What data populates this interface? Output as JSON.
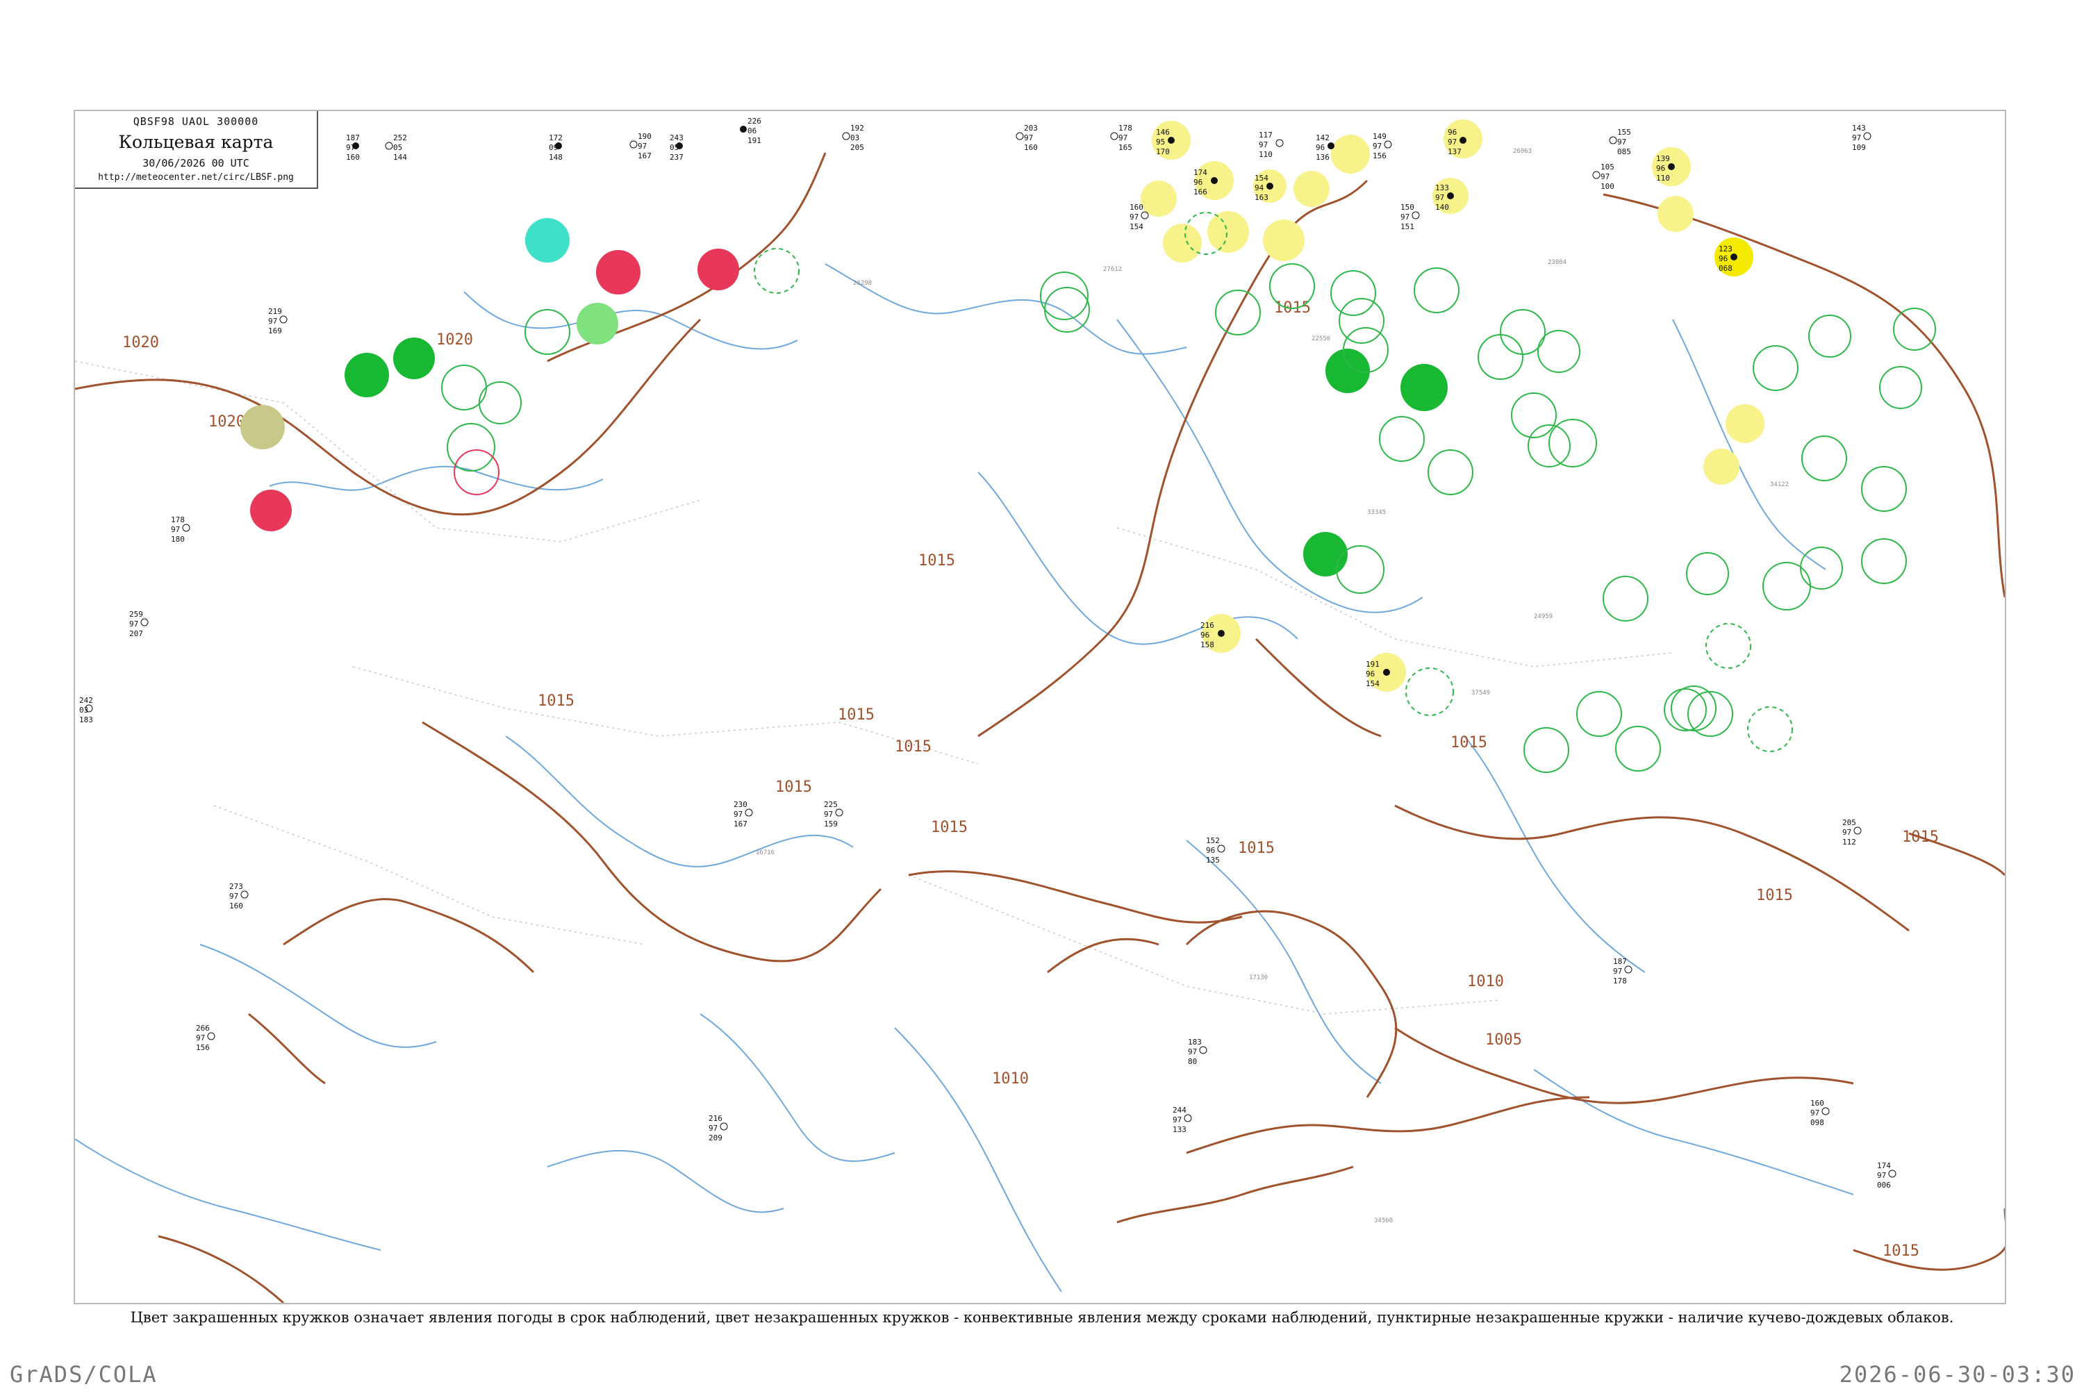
{
  "header": {
    "code": "QBSF98  UAOL  300000",
    "title": "Кольцевая карта",
    "time": "30/06/2026 00 UTC",
    "url": "http://meteocenter.net/circ/LBSF.png"
  },
  "legend_note": "Цвет закрашенных кружков означает явления погоды в срок наблюдений, цвет незакрашенных кружков - конвективные явления между сроками наблюдений, пунктирные незакрашенные кружки - наличие кучево-дождевых облаков.",
  "footer": {
    "left": "GrADS/COLA",
    "right": "2026-06-30-03:30"
  },
  "colors": {
    "isobar": "#a0522d",
    "river": "#6fa8dc",
    "fog_dust": "#c8c88a",
    "thunder": "#e8385a",
    "rain": "#18b832",
    "shower": "#7fe27f",
    "haze": "#3fe0c8",
    "dry": "#f7f28a",
    "convective_ring": "#2fb84a"
  },
  "isobar_labels": [
    "1020",
    "1020",
    "1020",
    "1015",
    "1015",
    "1015",
    "1015",
    "1015",
    "1015",
    "1015",
    "1015",
    "1015",
    "1015",
    "1010",
    "1010",
    "1005",
    "1015",
    "1015"
  ],
  "stations": [
    {
      "t": "187",
      "d": "97",
      "p": "160"
    },
    {
      "t": "252",
      "d": "05",
      "p": "144"
    },
    {
      "t": "172",
      "d": "09",
      "p": "148"
    },
    {
      "t": "190",
      "d": "97",
      "p": "167"
    },
    {
      "t": "243",
      "d": "05",
      "p": "237"
    },
    {
      "t": "226",
      "d": "06",
      "p": "191"
    },
    {
      "t": "192",
      "d": "03",
      "p": "205"
    },
    {
      "t": "203",
      "d": "97",
      "p": "160"
    },
    {
      "t": "178",
      "d": "97",
      "p": "165"
    },
    {
      "t": "146",
      "d": "95",
      "p": "170"
    },
    {
      "t": "117",
      "d": "97",
      "p": "110"
    },
    {
      "t": "142",
      "d": "96",
      "p": "136"
    },
    {
      "t": "149",
      "d": "97",
      "p": "156"
    },
    {
      "t": "96",
      "d": "97",
      "p": "137"
    },
    {
      "t": "155",
      "d": "97",
      "p": "085"
    },
    {
      "t": "139",
      "d": "96",
      "p": "110"
    },
    {
      "t": "105",
      "d": "97",
      "p": "100"
    },
    {
      "t": "143",
      "d": "97",
      "p": "109"
    },
    {
      "t": "174",
      "d": "96",
      "p": "166"
    },
    {
      "t": "160",
      "d": "97",
      "p": "154"
    },
    {
      "t": "154",
      "d": "94",
      "p": "163"
    },
    {
      "t": "150",
      "d": "97",
      "p": "151"
    },
    {
      "t": "133",
      "d": "97",
      "p": "140"
    },
    {
      "t": "123",
      "d": "96",
      "p": "068"
    },
    {
      "t": "219",
      "d": "97",
      "p": "169"
    },
    {
      "t": "216",
      "d": "96",
      "p": "158"
    },
    {
      "t": "191",
      "d": "96",
      "p": "154"
    },
    {
      "t": "178",
      "d": "97",
      "p": "180"
    },
    {
      "t": "242",
      "d": "03",
      "p": "183"
    },
    {
      "t": "259",
      "d": "97",
      "p": "207"
    },
    {
      "t": "225",
      "d": "97",
      "p": "159"
    },
    {
      "t": "230",
      "d": "97",
      "p": "167"
    },
    {
      "t": "152",
      "d": "96",
      "p": "135"
    },
    {
      "t": "187",
      "d": "97",
      "p": "178"
    },
    {
      "t": "183",
      "d": "97",
      "p": "80"
    },
    {
      "t": "244",
      "d": "97",
      "p": "133"
    },
    {
      "t": "273",
      "d": "97",
      "p": "160"
    },
    {
      "t": "266",
      "d": "97",
      "p": "156"
    },
    {
      "t": "216",
      "d": "97",
      "p": "209"
    },
    {
      "t": "174",
      "d": "97",
      "p": "006"
    },
    {
      "t": "205",
      "d": "97",
      "p": "112"
    },
    {
      "t": "160",
      "d": "97",
      "p": "098"
    }
  ],
  "station_ids": [
    "26063",
    "27612",
    "34122",
    "33345",
    "22550",
    "26298",
    "16716",
    "17130",
    "37549",
    "34560",
    "23804",
    "24959"
  ]
}
